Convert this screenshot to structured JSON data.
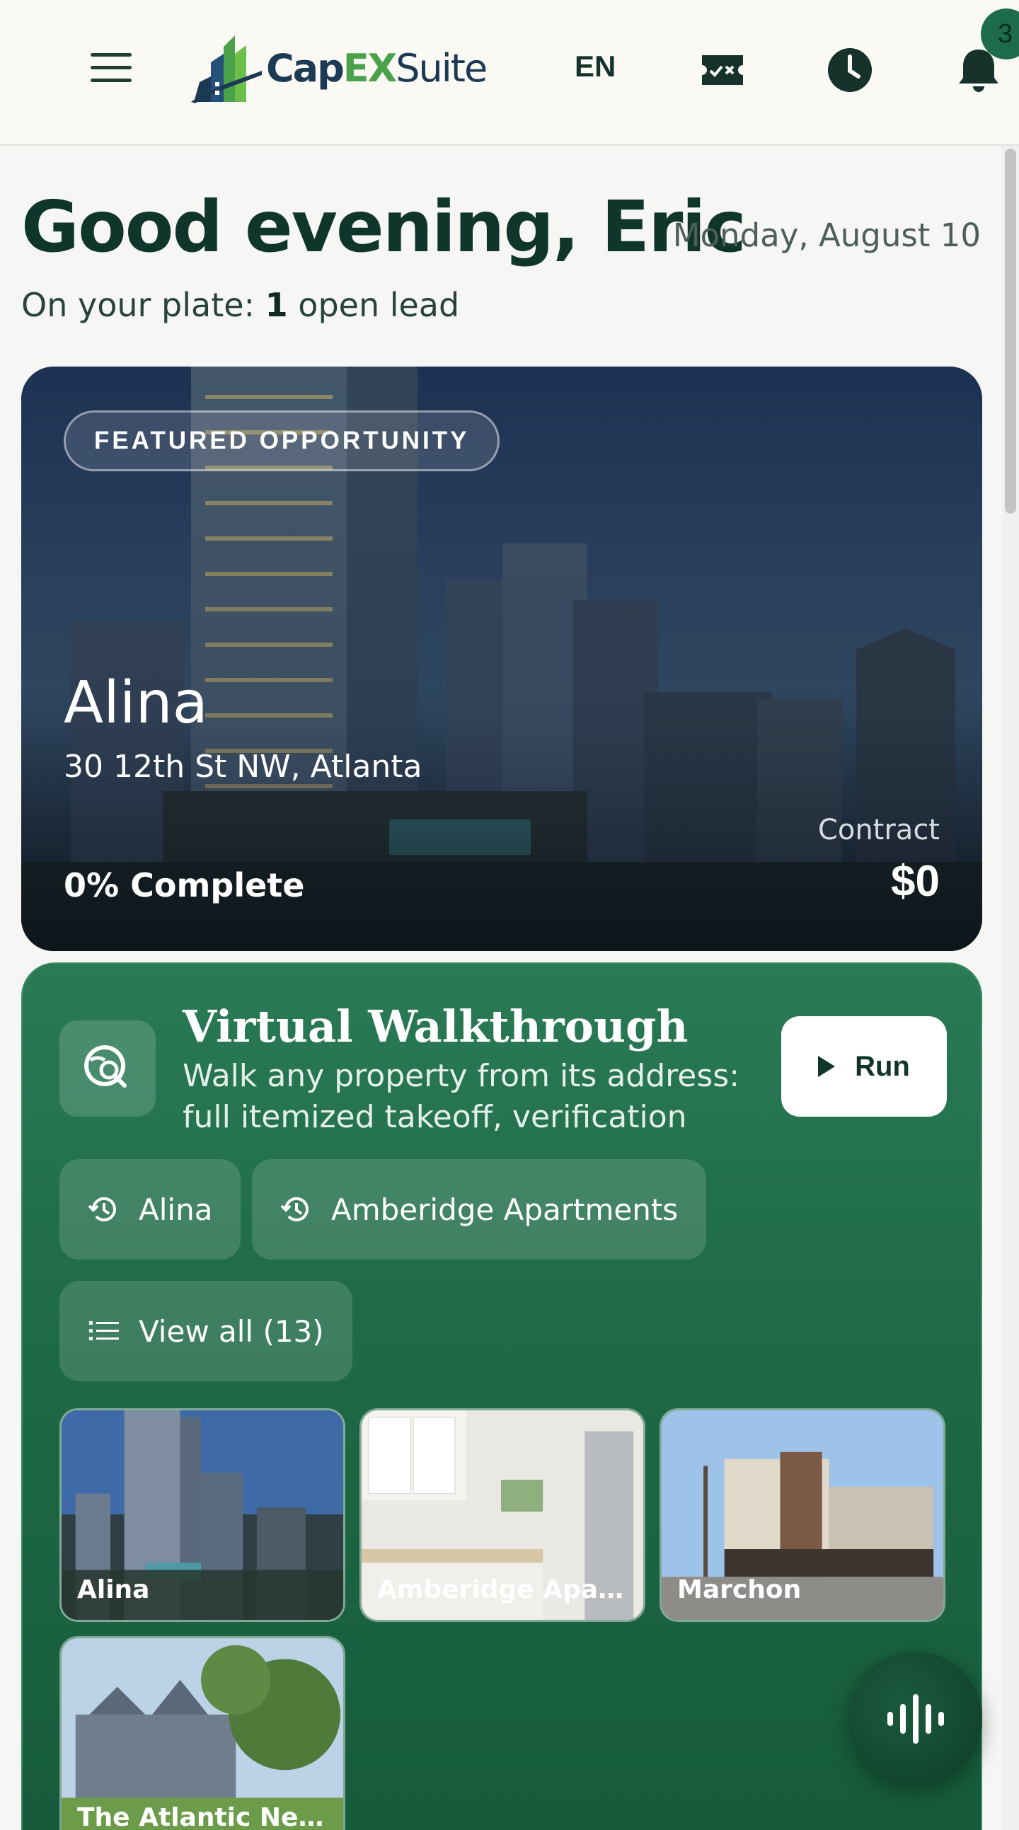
{
  "header": {
    "logo": {
      "part1": "Cap",
      "part2": "EX",
      "part3": "Suite"
    },
    "language": "EN",
    "notifications_count": "3"
  },
  "greeting": {
    "title": "Good evening, Eric",
    "date": "Monday, August 10",
    "plate_prefix": "On your plate: ",
    "plate_count": "1",
    "plate_suffix": " open lead"
  },
  "featured": {
    "badge": "FEATURED OPPORTUNITY",
    "name": "Alina",
    "address": "30 12th St NW, Atlanta",
    "complete": "0% Complete",
    "contract_label": "Contract",
    "contract_value": "$0"
  },
  "walkthrough": {
    "title": "Virtual Walkthrough",
    "description": "Walk any property from its address: full itemized takeoff, verification register,…",
    "run_label": "Run",
    "recent": [
      {
        "label": "Alina",
        "icon": "history-icon"
      },
      {
        "label": "Amberidge Apartments",
        "icon": "history-icon"
      }
    ],
    "view_all": "View all (13)",
    "properties": [
      {
        "label": "Alina"
      },
      {
        "label": "Amberidge Apartm…"
      },
      {
        "label": "Marchon"
      },
      {
        "label": "The Atlantic Newto…"
      }
    ]
  },
  "colors": {
    "brand_green": "#1f6a47",
    "header_bg": "#fbf9f3",
    "text_dark": "#10352a"
  }
}
